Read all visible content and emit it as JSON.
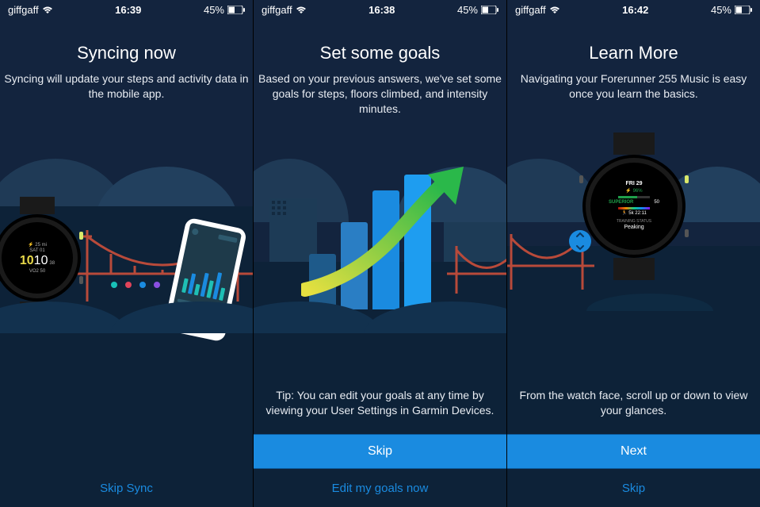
{
  "screens": [
    {
      "status": {
        "carrier": "giffgaff",
        "time": "16:39",
        "battery": "45%"
      },
      "title": "Syncing now",
      "subtitle": "Syncing will update your steps and activity data in the mobile app.",
      "watchface": {
        "dist": "25 mi",
        "day": "SAT 01",
        "time_h": "10",
        "time_m": "10",
        "sec": "38",
        "vo2": "VO2 50"
      },
      "dot_colors": [
        "#18c1b8",
        "#e0445a",
        "#1a8be0",
        "#8a4fe0"
      ],
      "phone_bars": [
        {
          "h": 18,
          "c": "#1fbfb5"
        },
        {
          "h": 26,
          "c": "#1a8be0"
        },
        {
          "h": 14,
          "c": "#1fbfb5"
        },
        {
          "h": 30,
          "c": "#1a8be0"
        },
        {
          "h": 22,
          "c": "#1fbfb5"
        },
        {
          "h": 34,
          "c": "#1a8be0"
        },
        {
          "h": 16,
          "c": "#1fbfb5"
        }
      ],
      "secondary": "Skip Sync"
    },
    {
      "status": {
        "carrier": "giffgaff",
        "time": "16:38",
        "battery": "45%"
      },
      "title": "Set some goals",
      "subtitle": "Based on your previous answers, we've set some goals for steps, floors climbed, and intensity minutes.",
      "tip": "Tip: You can edit your goals at any time by viewing your User Settings in Garmin Devices.",
      "primary": "Skip",
      "secondary": "Edit my goals now"
    },
    {
      "status": {
        "carrier": "giffgaff",
        "time": "16:42",
        "battery": "45%"
      },
      "title": "Learn More",
      "subtitle": "Navigating your Forerunner 255 Music is easy once you learn the basics.",
      "watchface": {
        "day": "FRI 29",
        "pct": "96%",
        "status": "SUPERIOR",
        "val": "50",
        "run": "5k 22:11",
        "ts_label": "TRAINING STATUS",
        "ts_val": "Peaking"
      },
      "tip": "From the watch face, scroll up or down to view your glances.",
      "primary": "Next",
      "secondary": "Skip"
    }
  ]
}
